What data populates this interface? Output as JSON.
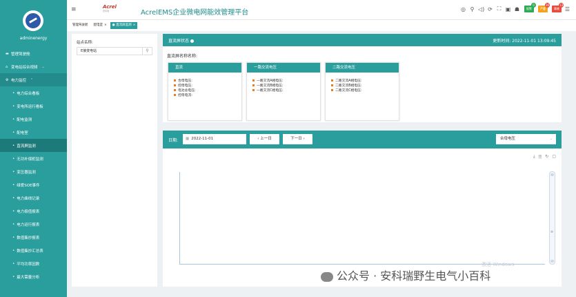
{
  "sidebar": {
    "username": "adminenergy",
    "items": [
      {
        "label": "管理驾驶舱",
        "icon": "monitor-icon",
        "level": 1
      },
      {
        "label": "变电站综合视频",
        "icon": "home-icon",
        "level": 1,
        "chevron": "⌄"
      },
      {
        "label": "电力监控",
        "icon": "bolt-icon",
        "level": 1,
        "chevron": "⌃",
        "open": true
      },
      {
        "label": "电力综合看板",
        "level": 2
      },
      {
        "label": "变电所运行看板",
        "level": 2
      },
      {
        "label": "配电监测",
        "level": 2
      },
      {
        "label": "配电室",
        "level": 2
      },
      {
        "label": "直流屏监测",
        "level": 2,
        "active": true
      },
      {
        "label": "无功补偿柜监测",
        "level": 2
      },
      {
        "label": "变压器监测",
        "level": 2
      },
      {
        "label": "绿爱SOE事件",
        "level": 2
      },
      {
        "label": "电力曲线记录",
        "level": 2
      },
      {
        "label": "电力极值报表",
        "level": 2
      },
      {
        "label": "电力运行报表",
        "level": 2
      },
      {
        "label": "数值集抄报表",
        "level": 2
      },
      {
        "label": "数值集抄汇总表",
        "level": 2
      },
      {
        "label": "平均功率因数",
        "level": 2
      },
      {
        "label": "最大需量分析",
        "level": 2
      }
    ]
  },
  "header": {
    "brand": "Acrel",
    "brand_sub": "安科瑞",
    "title": "AcrelEMS企业微电网能效管理平台",
    "tools": [
      "◎",
      "⚲",
      "◁)",
      "⟳",
      "⛶",
      "▣",
      "☗"
    ],
    "badges": [
      {
        "label": "报警",
        "count": "0",
        "color": "#2eaa55"
      },
      {
        "label": "严重",
        "count": "30",
        "color": "#f2a320"
      },
      {
        "label": "事故",
        "count": "13",
        "color": "#e74c3c"
      }
    ],
    "more": "☰"
  },
  "tabs": [
    {
      "label": "管理驾驶舱",
      "closable": false,
      "active": false
    },
    {
      "label": "配电室",
      "closable": true,
      "active": false
    },
    {
      "label": "直流屏监测",
      "closable": true,
      "active": true
    }
  ],
  "station": {
    "label": "站点名称:",
    "value": "E接变电站"
  },
  "status_panel": {
    "title": "直流屏状态",
    "update_label": "更新时间: 2022-11-01 13:09:45",
    "screen_name_label": "直流屏名称名称:",
    "cards": [
      {
        "title": "直流",
        "rows": [
          "合母电压:",
          "控母电压:",
          "电池总电压:",
          "控母电流:"
        ]
      },
      {
        "title": "一路交流电压",
        "rows": [
          "一路交流A相电压:",
          "一路交流B相电压:",
          "一路交流C相电压:"
        ]
      },
      {
        "title": "二路交流电压",
        "rows": [
          "二路交流A相电压:",
          "二路交流B相电压:",
          "二路交流C相电压:"
        ]
      }
    ]
  },
  "query": {
    "date_label": "日期:",
    "date_value": "2022-11-01",
    "prev_label": "‹ 上一日",
    "next_label": "下一日 ›",
    "select_value": "合母电压"
  },
  "chart_tools": [
    "⤓",
    "🗎",
    "↻",
    "▢"
  ],
  "watermarks": {
    "windows": "激活 Windows",
    "wechat": "公众号 · 安科瑞野生电气小百科"
  }
}
